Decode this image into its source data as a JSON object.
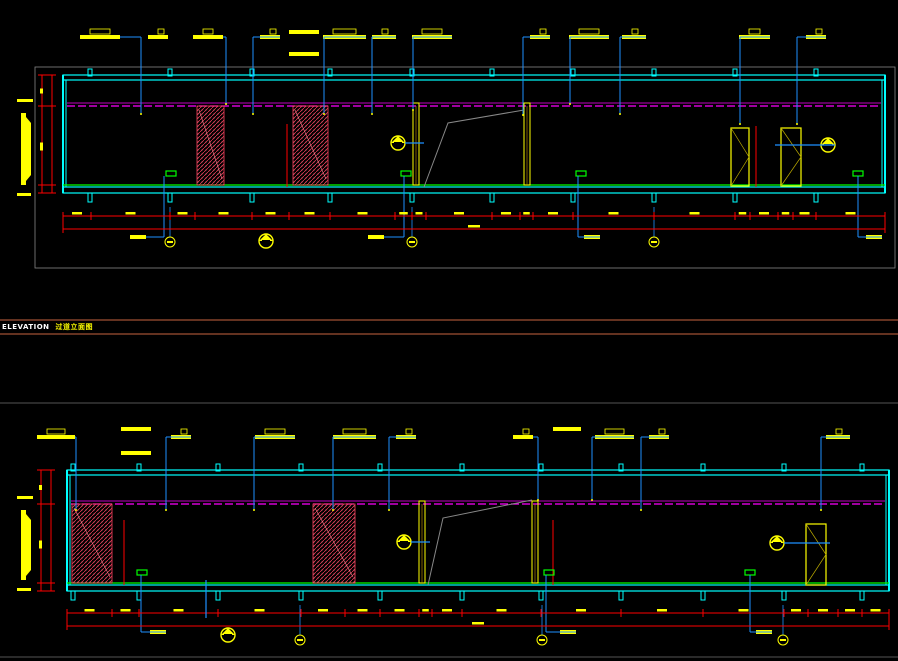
{
  "section": {
    "title_en": "ELEVATION",
    "title_zh": "过道立面图"
  },
  "colors": {
    "background": "#000000",
    "wall": "#00ffff",
    "floor": "#00ff00",
    "ceiling_line": "#ff00ff",
    "leader": "#1e90ff",
    "dimension": "#ff0000",
    "tag": "#ffff00",
    "floor_tag": "#00ff00",
    "frame": "#888888",
    "title_line": "#c86440"
  },
  "icons": [
    "section-marker-icon",
    "elevation-marker-icon",
    "material-tag-icon",
    "grid-bubble-icon"
  ]
}
